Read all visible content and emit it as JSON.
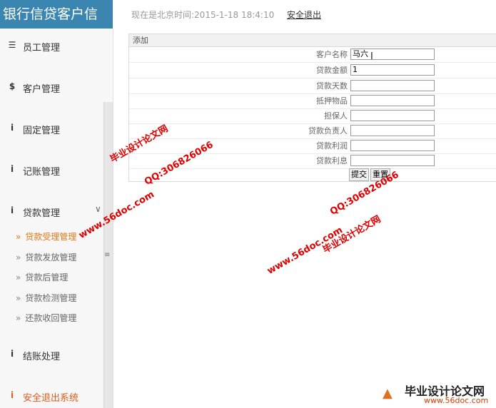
{
  "brand": {
    "title": "银行信贷客户信"
  },
  "topbar": {
    "time_text": "现在是北京时间:2015-1-18 18:4:10",
    "logout_label": "安全退出"
  },
  "sidebar": {
    "items": [
      {
        "label": "员工管理",
        "icon": "list-icon"
      },
      {
        "label": "客户管理",
        "icon": "dollar-icon"
      },
      {
        "label": "固定管理",
        "icon": "info-icon"
      },
      {
        "label": "记账管理",
        "icon": "info-icon"
      },
      {
        "label": "贷款管理",
        "icon": "info-icon",
        "expanded": true
      },
      {
        "label": "结账处理",
        "icon": "info-icon"
      },
      {
        "label": "安全退出系统",
        "icon": "info-icon"
      }
    ],
    "subitems": [
      {
        "label": "贷款受理管理",
        "active": true
      },
      {
        "label": "贷款发放管理"
      },
      {
        "label": "贷款后管理"
      },
      {
        "label": "贷款检测管理"
      },
      {
        "label": "还款收回管理"
      }
    ]
  },
  "form": {
    "header": "添加",
    "fields": [
      {
        "label": "客户名称",
        "value": "马六"
      },
      {
        "label": "贷款金额",
        "value": "1"
      },
      {
        "label": "贷款天数",
        "value": ""
      },
      {
        "label": "抵押物品",
        "value": ""
      },
      {
        "label": "担保人",
        "value": ""
      },
      {
        "label": "贷款负责人",
        "value": ""
      },
      {
        "label": "贷款利润",
        "value": ""
      },
      {
        "label": "贷款利息",
        "value": ""
      }
    ],
    "submit_label": "提交",
    "reset_label": "重置"
  },
  "watermarks": {
    "site_name": "毕业设计论文网",
    "site_url": "www.56doc.com",
    "qq": "QQ:306826066",
    "logo_url": "www.56doc.com"
  },
  "colors": {
    "brand_bg": "#3b86b0",
    "active_menu": "#e0781a",
    "exit_menu": "#e05b1a",
    "watermark": "#e00000"
  }
}
